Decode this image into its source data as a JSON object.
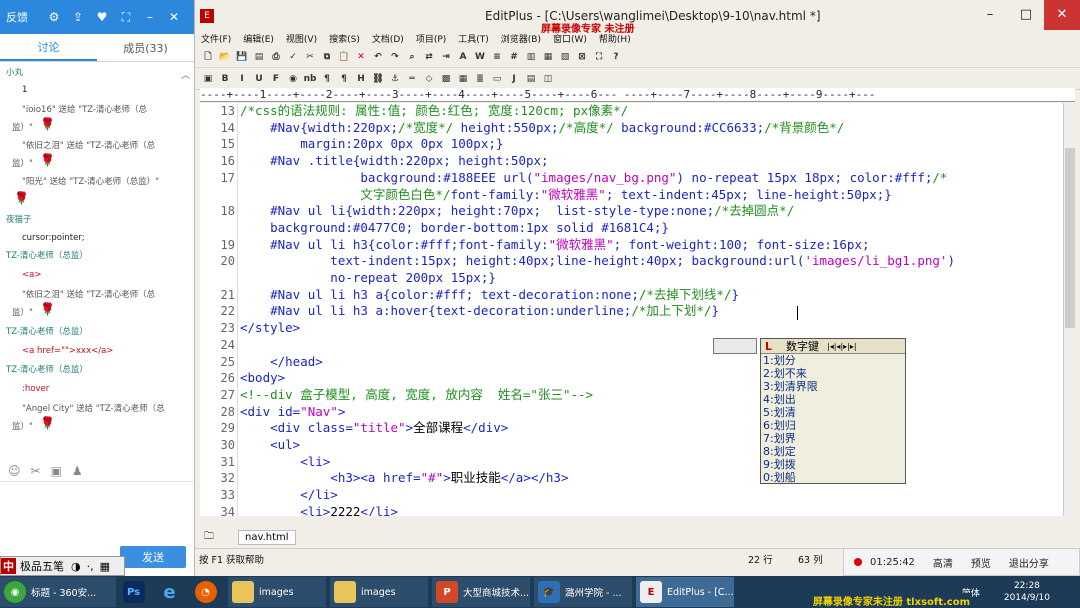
{
  "chat": {
    "header": {
      "feedback": "反馈",
      "icons": [
        "gear-icon",
        "share-icon",
        "heart-icon",
        "fullscreen-icon",
        "minimize-icon",
        "close-icon"
      ]
    },
    "tabs": [
      {
        "label": "讨论",
        "active": true
      },
      {
        "label": "成员(33)",
        "active": false
      }
    ],
    "messages": [
      {
        "text": "小丸",
        "style": "teal"
      },
      {
        "text": "1",
        "style": "dark"
      },
      {
        "text": "\"ioio16\" 送给 \"TZ-清心老师（总",
        "style": "gray"
      },
      {
        "text": "监）\"",
        "style": "gray"
      },
      {
        "text": "\"依旧之泪\" 送给 \"TZ-清心老师（总",
        "style": "gray"
      },
      {
        "text": "监）\"",
        "style": "gray"
      },
      {
        "text": "\"阳光\" 送给 \"TZ-清心老师（总监）\"",
        "style": "gray"
      },
      {
        "text": "夜猫子",
        "style": "teal"
      },
      {
        "text": "cursor:pointer;",
        "style": "dark"
      },
      {
        "text": "TZ-清心老师（总监）",
        "style": "teal"
      },
      {
        "text": "<a>",
        "style": "red"
      },
      {
        "text": "\"依旧之泪\" 送给 \"TZ-清心老师（总",
        "style": "gray"
      },
      {
        "text": "监）\"",
        "style": "gray"
      },
      {
        "text": "TZ-清心老师（总监）",
        "style": "teal"
      },
      {
        "text": "<a href=\"\">xxx</a>",
        "style": "red"
      },
      {
        "text": "TZ-清心老师（总监）",
        "style": "teal"
      },
      {
        "text": ":hover",
        "style": "red"
      },
      {
        "text": "\"Angel City\" 送给 \"TZ-清心老师（总",
        "style": "gray"
      },
      {
        "text": "监）\"",
        "style": "gray"
      }
    ],
    "send_label": "发送",
    "ime_label": "极品五笔"
  },
  "editplus": {
    "title": "EditPlus - [C:\\Users\\wanglimei\\Desktop\\9-10\\nav.html *]",
    "watermark": "屏幕录像专家 未注册",
    "menu": [
      "文件(F)",
      "编辑(E)",
      "视图(V)",
      "搜索(S)",
      "文档(D)",
      "项目(P)",
      "工具(T)",
      "浏览器(B)",
      "窗口(W)",
      "帮助(H)"
    ],
    "ruler": "----+----1----+----2----+----3----+----4----+----5----+----6--- ----+----7----+----8----+----9----+---",
    "line_numbers": [
      "13",
      "14",
      "15",
      "16",
      "17",
      "",
      "18",
      "",
      "19",
      "20",
      "",
      "21",
      "22",
      "23",
      "24",
      "25",
      "26",
      "27",
      "28",
      "29",
      "30",
      "31",
      "32",
      "33",
      "34"
    ],
    "file_tab": "nav.html",
    "status": {
      "help": "按 F1 获取帮助",
      "line": "22 行",
      "col": "63 列"
    }
  },
  "ime_candidates": {
    "header": "数字键",
    "items": [
      "1:划分",
      "2:划不来",
      "3:划清界限",
      "4:划出",
      "5:划清",
      "6:划归",
      "7:划界",
      "8:划定",
      "9:划拨",
      "0:划船"
    ]
  },
  "recorder": {
    "time": "01:25:42",
    "buttons": [
      "高清",
      "预览",
      "退出分享"
    ]
  },
  "taskbar": {
    "items": [
      "标题 - 360安...",
      "",
      "",
      "",
      "images",
      "images",
      "大型商城技术...",
      "潞州学院 - ...",
      "EditPlus - [C..."
    ],
    "lang": "简体",
    "time": "22:28",
    "date": "2014/9/10",
    "watermark": "屏幕录像专家未注册 tlxsoft.com"
  }
}
